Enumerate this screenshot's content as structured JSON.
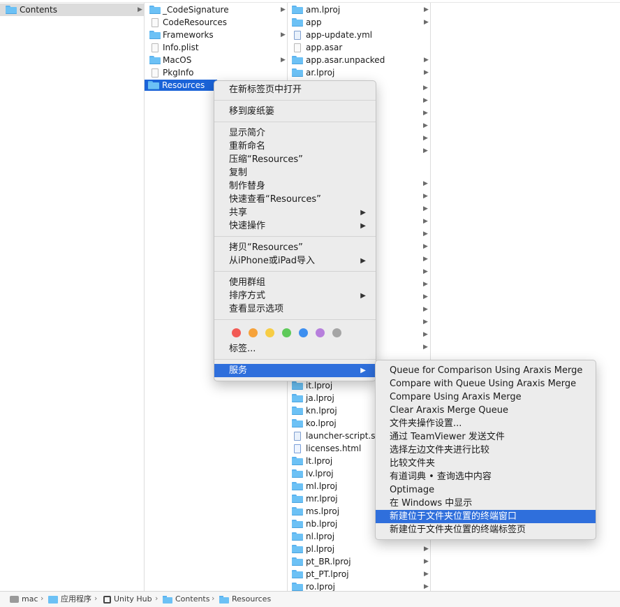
{
  "column1": {
    "items": [
      {
        "label": "Contents",
        "icon": "folder-icon",
        "has_children": true,
        "state": "selected-inactive"
      }
    ]
  },
  "column2": {
    "items": [
      {
        "label": "_CodeSignature",
        "icon": "folder-icon",
        "has_children": true
      },
      {
        "label": "CodeResources",
        "icon": "document-icon",
        "has_children": false
      },
      {
        "label": "Frameworks",
        "icon": "folder-icon",
        "has_children": true
      },
      {
        "label": "Info.plist",
        "icon": "document-icon",
        "has_children": false
      },
      {
        "label": "MacOS",
        "icon": "folder-icon",
        "has_children": true
      },
      {
        "label": "PkgInfo",
        "icon": "document-icon",
        "has_children": false
      },
      {
        "label": "Resources",
        "icon": "folder-icon",
        "has_children": true,
        "state": "selected-active"
      }
    ]
  },
  "column3": {
    "top_items": [
      {
        "label": "am.lproj",
        "icon": "folder-icon"
      },
      {
        "label": "app",
        "icon": "folder-icon"
      },
      {
        "label": "app-update.yml",
        "icon": "document-icon"
      },
      {
        "label": "app.asar",
        "icon": "document-icon"
      },
      {
        "label": "app.asar.unpacked",
        "icon": "folder-icon"
      },
      {
        "label": "ar.lproj",
        "icon": "folder-icon"
      }
    ],
    "bottom_items": [
      {
        "label": "it.lproj",
        "icon": "folder-icon"
      },
      {
        "label": "ja.lproj",
        "icon": "folder-icon"
      },
      {
        "label": "kn.lproj",
        "icon": "folder-icon"
      },
      {
        "label": "ko.lproj",
        "icon": "folder-icon"
      },
      {
        "label": "launcher-script.sh",
        "icon": "script-icon"
      },
      {
        "label": "licenses.html",
        "icon": "html-file-icon"
      },
      {
        "label": "lt.lproj",
        "icon": "folder-icon"
      },
      {
        "label": "lv.lproj",
        "icon": "folder-icon"
      },
      {
        "label": "ml.lproj",
        "icon": "folder-icon"
      },
      {
        "label": "mr.lproj",
        "icon": "folder-icon"
      },
      {
        "label": "ms.lproj",
        "icon": "folder-icon"
      },
      {
        "label": "nb.lproj",
        "icon": "folder-icon"
      },
      {
        "label": "nl.lproj",
        "icon": "folder-icon"
      },
      {
        "label": "pl.lproj",
        "icon": "folder-icon"
      },
      {
        "label": "pt_BR.lproj",
        "icon": "folder-icon"
      },
      {
        "label": "pt_PT.lproj",
        "icon": "folder-icon"
      },
      {
        "label": "ro.lproj",
        "icon": "folder-icon"
      }
    ]
  },
  "context_menu": {
    "open_in_new_tab": "在新标签页中打开",
    "move_to_trash": "移到废纸篓",
    "get_info": "显示简介",
    "rename": "重新命名",
    "compress": "压缩“Resources”",
    "duplicate": "复制",
    "make_alias": "制作替身",
    "quick_look": "快速查看“Resources”",
    "share": "共享",
    "quick_actions": "快速操作",
    "copy": "拷贝“Resources”",
    "import_from_iphone": "从iPhone或iPad导入",
    "use_groups": "使用群组",
    "sort_by": "排序方式",
    "show_view_options": "查看显示选项",
    "tags": "标签...",
    "services": "服务",
    "tag_colors": [
      "#f25a55",
      "#f6a23a",
      "#f7cd45",
      "#5fca5a",
      "#3d8ff0",
      "#b77fdc",
      "#a5a5a5"
    ]
  },
  "services_submenu": {
    "items": [
      "Queue for Comparison Using Araxis Merge",
      "Compare with Queue Using Araxis Merge",
      "Compare Using Araxis Merge",
      "Clear Araxis Merge Queue",
      "文件夹操作设置...",
      "通过 TeamViewer 发送文件",
      "选择左边文件夹进行比较",
      "比较文件夹",
      "有道词典 • 查询选中内容",
      "Optimage",
      "在 Windows 中显示",
      "新建位于文件夹位置的终端窗口",
      "新建位于文件夹位置的终端标签页"
    ],
    "highlighted_index": 11
  },
  "path_bar": {
    "crumbs": [
      "mac",
      "应用程序",
      "Unity Hub",
      "Contents",
      "Resources"
    ],
    "separator": "›"
  },
  "colors": {
    "selection_blue": "#1a63d8",
    "menu_highlight": "#2f6fdc",
    "folder_blue": "#6cc1f5"
  }
}
